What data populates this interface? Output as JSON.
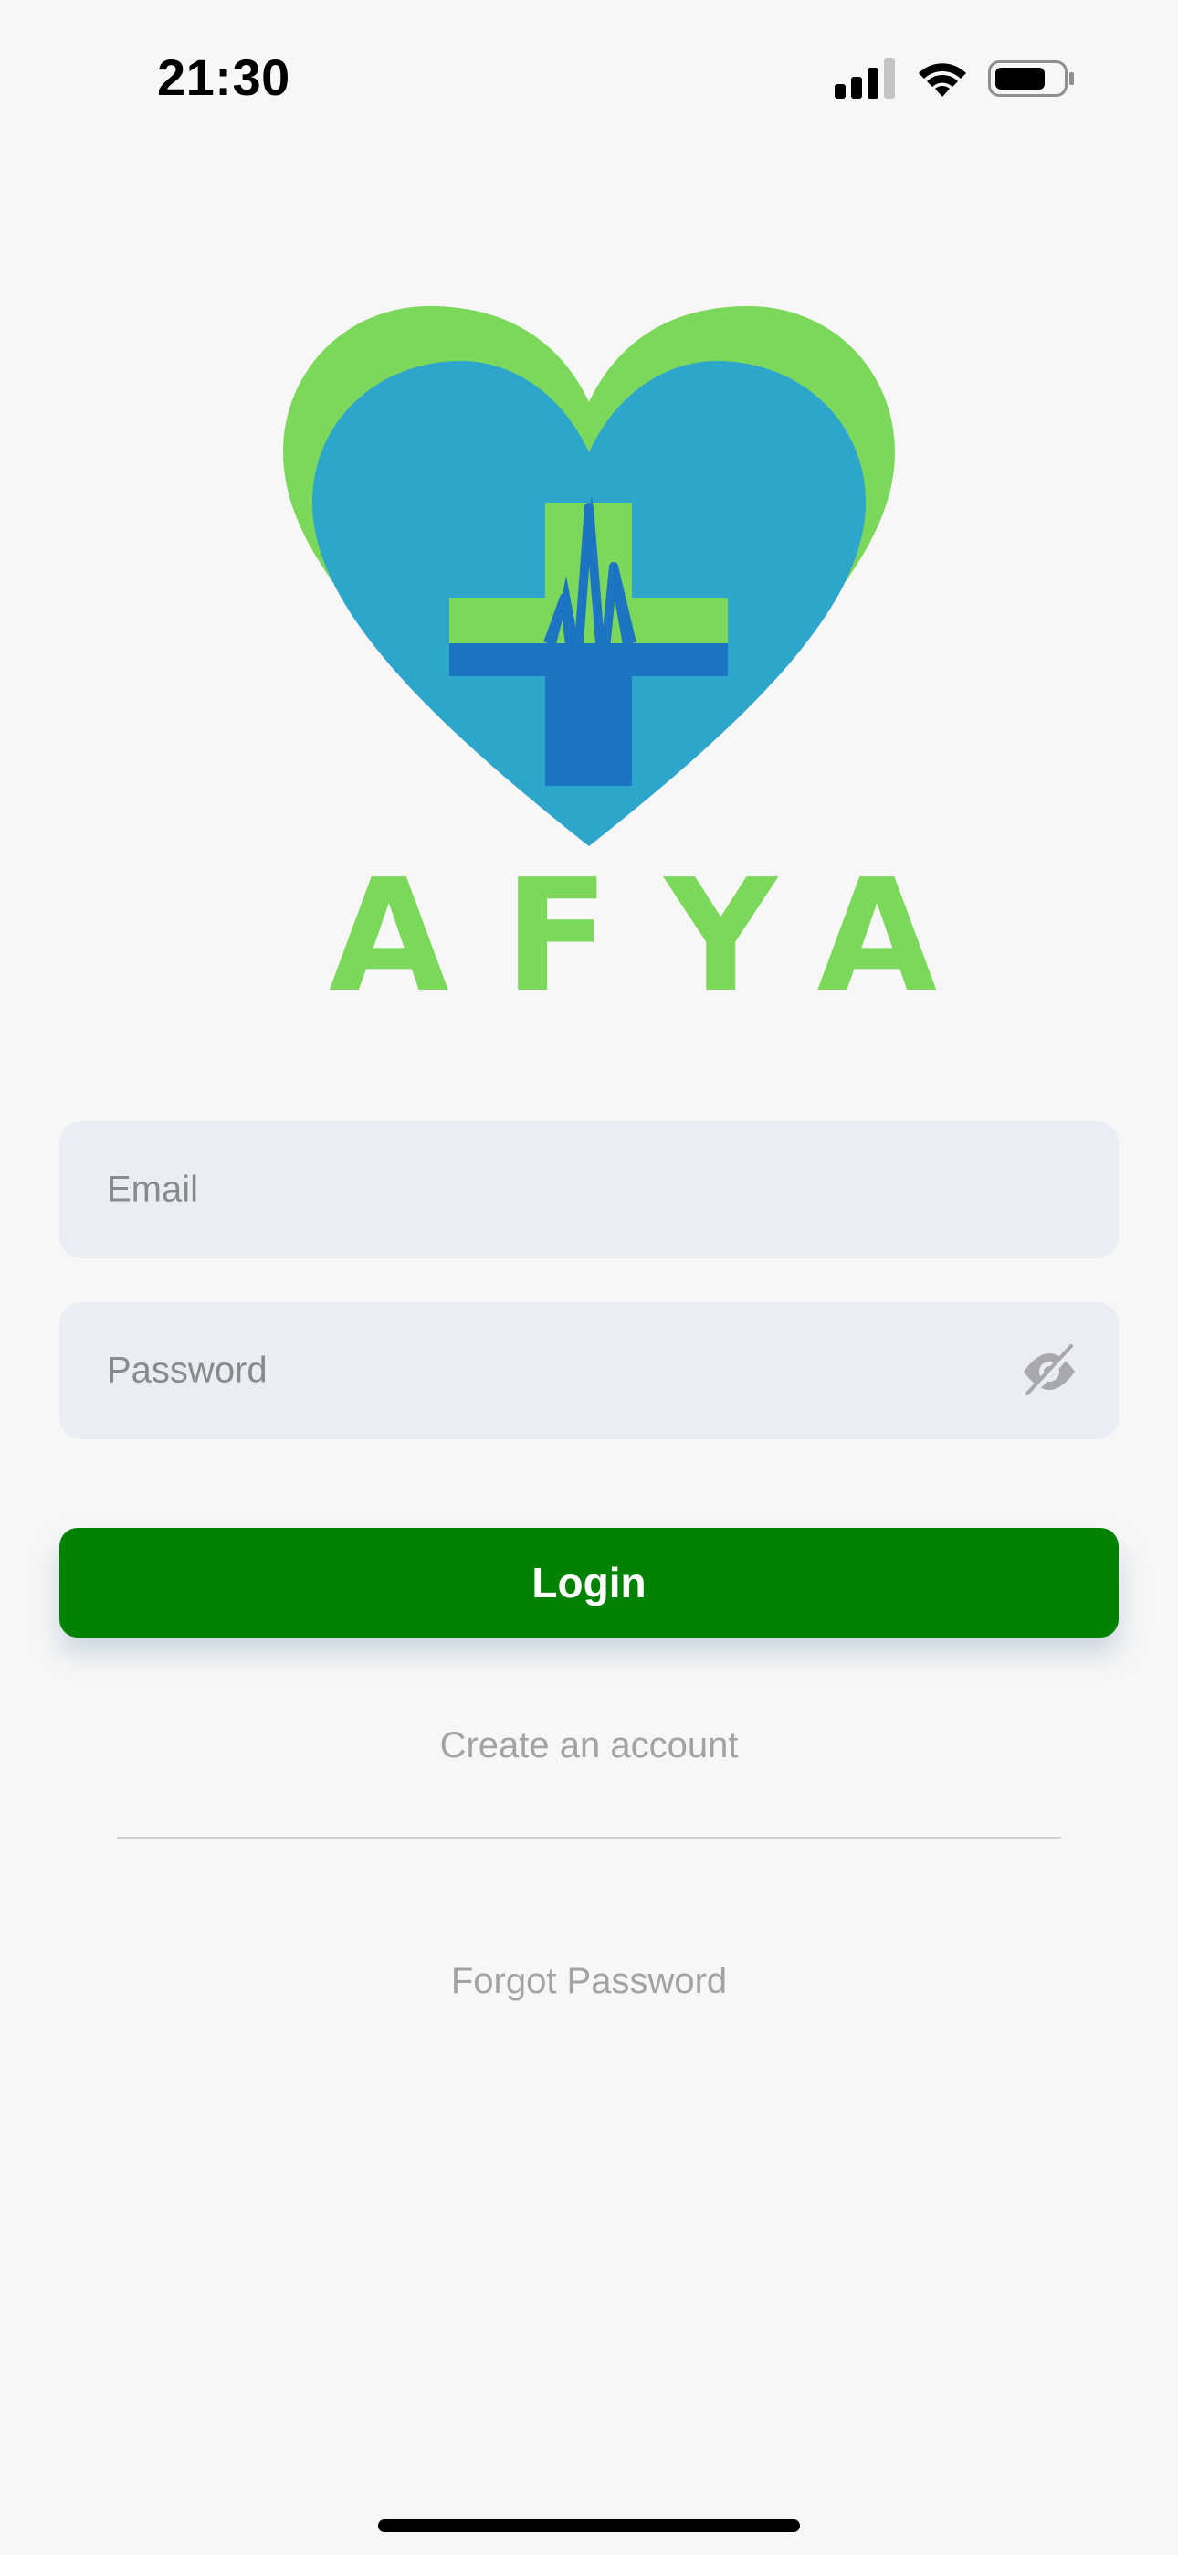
{
  "status_bar": {
    "time": "21:30",
    "icons": [
      "cellular-signal-icon",
      "wifi-icon",
      "battery-icon"
    ]
  },
  "logo": {
    "text": "AFYA",
    "icon": "heart-medical-cross-logo",
    "colors": {
      "heart_outer": "#7cd85a",
      "heart_inner": "#2ea6cc",
      "cross_green": "#7cd85a",
      "cross_blue": "#1c74c2",
      "text": "#7cd85a"
    }
  },
  "form": {
    "email_placeholder": "Email",
    "password_placeholder": "Password",
    "password_toggle_icon": "eye-slash-icon",
    "login_label": "Login"
  },
  "links": {
    "create_account": "Create an account",
    "forgot_password": "Forgot Password"
  },
  "theme": {
    "background": "#f7f7f7",
    "field_background": "#eaedf4",
    "primary_button": "#028202",
    "link_text": "#a3a3a6"
  }
}
